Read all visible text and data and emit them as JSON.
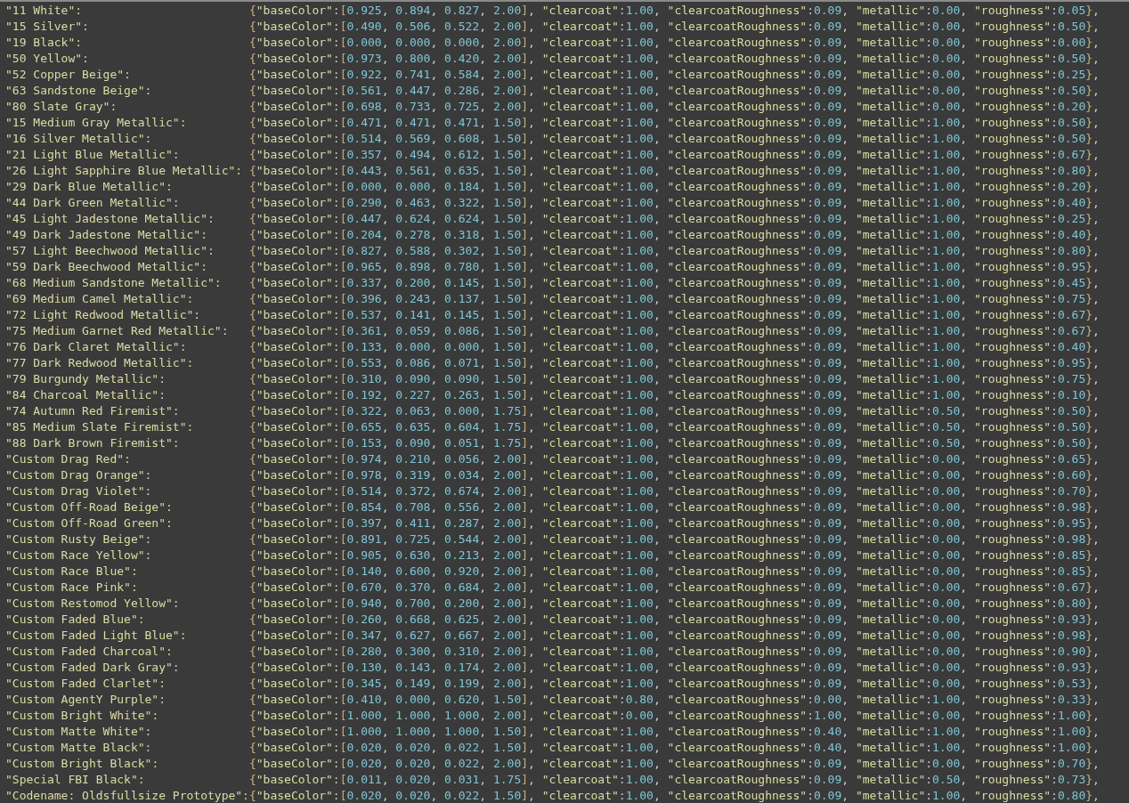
{
  "editor": {
    "lines": [
      {
        "key": "\"11 White\":",
        "code": "{\"baseColor\":[0.925, 0.894, 0.827, 2.00], \"clearcoat\":1.00, \"clearcoatRoughness\":0.09, \"metallic\":0.00, \"roughness\":0.05},"
      },
      {
        "key": "\"15 Silver\":",
        "code": "{\"baseColor\":[0.490, 0.506, 0.522, 2.00], \"clearcoat\":1.00, \"clearcoatRoughness\":0.09, \"metallic\":0.00, \"roughness\":0.50},"
      },
      {
        "key": "\"19 Black\":",
        "code": "{\"baseColor\":[0.000, 0.000, 0.000, 2.00], \"clearcoat\":1.00, \"clearcoatRoughness\":0.09, \"metallic\":0.00, \"roughness\":0.00},"
      },
      {
        "key": "\"50 Yellow\":",
        "code": "{\"baseColor\":[0.973, 0.800, 0.420, 2.00], \"clearcoat\":1.00, \"clearcoatRoughness\":0.09, \"metallic\":0.00, \"roughness\":0.50},"
      },
      {
        "key": "\"52 Copper Beige\":",
        "code": "{\"baseColor\":[0.922, 0.741, 0.584, 2.00], \"clearcoat\":1.00, \"clearcoatRoughness\":0.09, \"metallic\":0.00, \"roughness\":0.25},"
      },
      {
        "key": "\"63 Sandstone Beige\":",
        "code": "{\"baseColor\":[0.561, 0.447, 0.286, 2.00], \"clearcoat\":1.00, \"clearcoatRoughness\":0.09, \"metallic\":0.00, \"roughness\":0.50},"
      },
      {
        "key": "\"80 Slate Gray\":",
        "code": "{\"baseColor\":[0.698, 0.733, 0.725, 2.00], \"clearcoat\":1.00, \"clearcoatRoughness\":0.09, \"metallic\":0.00, \"roughness\":0.20},"
      },
      {
        "key": "\"15 Medium Gray Metallic\":",
        "code": "{\"baseColor\":[0.471, 0.471, 0.471, 1.50], \"clearcoat\":1.00, \"clearcoatRoughness\":0.09, \"metallic\":1.00, \"roughness\":0.50},"
      },
      {
        "key": "\"16 Silver Metallic\":",
        "code": "{\"baseColor\":[0.514, 0.569, 0.608, 1.50], \"clearcoat\":1.00, \"clearcoatRoughness\":0.09, \"metallic\":1.00, \"roughness\":0.50},"
      },
      {
        "key": "\"21 Light Blue Metallic\":",
        "code": "{\"baseColor\":[0.357, 0.494, 0.612, 1.50], \"clearcoat\":1.00, \"clearcoatRoughness\":0.09, \"metallic\":1.00, \"roughness\":0.67},"
      },
      {
        "key": "\"26 Light Sapphire Blue Metallic\":",
        "code": "{\"baseColor\":[0.443, 0.561, 0.635, 1.50], \"clearcoat\":1.00, \"clearcoatRoughness\":0.09, \"metallic\":1.00, \"roughness\":0.80},"
      },
      {
        "key": "\"29 Dark Blue Metallic\":",
        "code": "{\"baseColor\":[0.000, 0.000, 0.184, 1.50], \"clearcoat\":1.00, \"clearcoatRoughness\":0.09, \"metallic\":1.00, \"roughness\":0.20},"
      },
      {
        "key": "\"44 Dark Green Metallic\":",
        "code": "{\"baseColor\":[0.290, 0.463, 0.322, 1.50], \"clearcoat\":1.00, \"clearcoatRoughness\":0.09, \"metallic\":1.00, \"roughness\":0.40},"
      },
      {
        "key": "\"45 Light Jadestone Metallic\":",
        "code": "{\"baseColor\":[0.447, 0.624, 0.624, 1.50], \"clearcoat\":1.00, \"clearcoatRoughness\":0.09, \"metallic\":1.00, \"roughness\":0.25},"
      },
      {
        "key": "\"49 Dark Jadestone Metallic\":",
        "code": "{\"baseColor\":[0.204, 0.278, 0.318, 1.50], \"clearcoat\":1.00, \"clearcoatRoughness\":0.09, \"metallic\":1.00, \"roughness\":0.40},"
      },
      {
        "key": "\"57 Light Beechwood Metallic\":",
        "code": "{\"baseColor\":[0.827, 0.588, 0.302, 1.50], \"clearcoat\":1.00, \"clearcoatRoughness\":0.09, \"metallic\":1.00, \"roughness\":0.80},"
      },
      {
        "key": "\"59 Dark Beechwood Metallic\":",
        "code": "{\"baseColor\":[0.965, 0.898, 0.780, 1.50], \"clearcoat\":1.00, \"clearcoatRoughness\":0.09, \"metallic\":1.00, \"roughness\":0.95},"
      },
      {
        "key": "\"68 Medium Sandstone Metallic\":",
        "code": "{\"baseColor\":[0.337, 0.200, 0.145, 1.50], \"clearcoat\":1.00, \"clearcoatRoughness\":0.09, \"metallic\":1.00, \"roughness\":0.45},"
      },
      {
        "key": "\"69 Medium Camel Metallic\":",
        "code": "{\"baseColor\":[0.396, 0.243, 0.137, 1.50], \"clearcoat\":1.00, \"clearcoatRoughness\":0.09, \"metallic\":1.00, \"roughness\":0.75},"
      },
      {
        "key": "\"72 Light Redwood Metallic\":",
        "code": "{\"baseColor\":[0.537, 0.141, 0.145, 1.50], \"clearcoat\":1.00, \"clearcoatRoughness\":0.09, \"metallic\":1.00, \"roughness\":0.67},"
      },
      {
        "key": "\"75 Medium Garnet Red Metallic\":",
        "code": "{\"baseColor\":[0.361, 0.059, 0.086, 1.50], \"clearcoat\":1.00, \"clearcoatRoughness\":0.09, \"metallic\":1.00, \"roughness\":0.67},"
      },
      {
        "key": "\"76 Dark Claret Metallic\":",
        "code": "{\"baseColor\":[0.133, 0.000, 0.000, 1.50], \"clearcoat\":1.00, \"clearcoatRoughness\":0.09, \"metallic\":1.00, \"roughness\":0.40},"
      },
      {
        "key": "\"77 Dark Redwood Metallic\":",
        "code": "{\"baseColor\":[0.553, 0.086, 0.071, 1.50], \"clearcoat\":1.00, \"clearcoatRoughness\":0.09, \"metallic\":1.00, \"roughness\":0.95},"
      },
      {
        "key": "\"79 Burgundy Metallic\":",
        "code": "{\"baseColor\":[0.310, 0.090, 0.090, 1.50], \"clearcoat\":1.00, \"clearcoatRoughness\":0.09, \"metallic\":1.00, \"roughness\":0.75},"
      },
      {
        "key": "\"84 Charcoal Metallic\":",
        "code": "{\"baseColor\":[0.192, 0.227, 0.263, 1.50], \"clearcoat\":1.00, \"clearcoatRoughness\":0.09, \"metallic\":1.00, \"roughness\":0.10},"
      },
      {
        "key": "\"74 Autumn Red Firemist\":",
        "code": "{\"baseColor\":[0.322, 0.063, 0.000, 1.75], \"clearcoat\":1.00, \"clearcoatRoughness\":0.09, \"metallic\":0.50, \"roughness\":0.50},"
      },
      {
        "key": "\"85 Medium Slate Firemist\":",
        "code": "{\"baseColor\":[0.655, 0.635, 0.604, 1.75], \"clearcoat\":1.00, \"clearcoatRoughness\":0.09, \"metallic\":0.50, \"roughness\":0.50},"
      },
      {
        "key": "\"88 Dark Brown Firemist\":",
        "code": "{\"baseColor\":[0.153, 0.090, 0.051, 1.75], \"clearcoat\":1.00, \"clearcoatRoughness\":0.09, \"metallic\":0.50, \"roughness\":0.50},"
      },
      {
        "key": "\"Custom Drag Red\":",
        "code": "{\"baseColor\":[0.974, 0.210, 0.056, 2.00], \"clearcoat\":1.00, \"clearcoatRoughness\":0.09, \"metallic\":0.00, \"roughness\":0.65},"
      },
      {
        "key": "\"Custom Drag Orange\":",
        "code": "{\"baseColor\":[0.978, 0.319, 0.034, 2.00], \"clearcoat\":1.00, \"clearcoatRoughness\":0.09, \"metallic\":0.00, \"roughness\":0.60},"
      },
      {
        "key": "\"Custom Drag Violet\":",
        "code": "{\"baseColor\":[0.514, 0.372, 0.674, 2.00], \"clearcoat\":1.00, \"clearcoatRoughness\":0.09, \"metallic\":0.00, \"roughness\":0.70},"
      },
      {
        "key": "\"Custom Off-Road Beige\":",
        "code": "{\"baseColor\":[0.854, 0.708, 0.556, 2.00], \"clearcoat\":1.00, \"clearcoatRoughness\":0.09, \"metallic\":0.00, \"roughness\":0.98},"
      },
      {
        "key": "\"Custom Off-Road Green\":",
        "code": "{\"baseColor\":[0.397, 0.411, 0.287, 2.00], \"clearcoat\":1.00, \"clearcoatRoughness\":0.09, \"metallic\":0.00, \"roughness\":0.95},"
      },
      {
        "key": "\"Custom Rusty Beige\":",
        "code": "{\"baseColor\":[0.891, 0.725, 0.544, 2.00], \"clearcoat\":1.00, \"clearcoatRoughness\":0.09, \"metallic\":0.00, \"roughness\":0.98},"
      },
      {
        "key": "\"Custom Race Yellow\":",
        "code": "{\"baseColor\":[0.905, 0.630, 0.213, 2.00], \"clearcoat\":1.00, \"clearcoatRoughness\":0.09, \"metallic\":0.00, \"roughness\":0.85},"
      },
      {
        "key": "\"Custom Race Blue\":",
        "code": "{\"baseColor\":[0.140, 0.600, 0.920, 2.00], \"clearcoat\":1.00, \"clearcoatRoughness\":0.09, \"metallic\":0.00, \"roughness\":0.85},"
      },
      {
        "key": "\"Custom Race Pink\":",
        "code": "{\"baseColor\":[0.670, 0.370, 0.684, 2.00], \"clearcoat\":1.00, \"clearcoatRoughness\":0.09, \"metallic\":0.00, \"roughness\":0.67},"
      },
      {
        "key": "\"Custom Restomod Yellow\":",
        "code": "{\"baseColor\":[0.940, 0.700, 0.200, 2.00], \"clearcoat\":1.00, \"clearcoatRoughness\":0.09, \"metallic\":0.00, \"roughness\":0.80},"
      },
      {
        "key": "\"Custom Faded Blue\":",
        "code": "{\"baseColor\":[0.260, 0.668, 0.625, 2.00], \"clearcoat\":1.00, \"clearcoatRoughness\":0.09, \"metallic\":0.00, \"roughness\":0.93},"
      },
      {
        "key": "\"Custom Faded Light Blue\":",
        "code": "{\"baseColor\":[0.347, 0.627, 0.667, 2.00], \"clearcoat\":1.00, \"clearcoatRoughness\":0.09, \"metallic\":0.00, \"roughness\":0.98},"
      },
      {
        "key": "\"Custom Faded Charcoal\":",
        "code": "{\"baseColor\":[0.280, 0.300, 0.310, 2.00], \"clearcoat\":1.00, \"clearcoatRoughness\":0.09, \"metallic\":0.00, \"roughness\":0.90},"
      },
      {
        "key": "\"Custom Faded Dark Gray\":",
        "code": "{\"baseColor\":[0.130, 0.143, 0.174, 2.00], \"clearcoat\":1.00, \"clearcoatRoughness\":0.09, \"metallic\":0.00, \"roughness\":0.93},"
      },
      {
        "key": "\"Custom Faded Clarlet\":",
        "code": "{\"baseColor\":[0.345, 0.149, 0.199, 2.00], \"clearcoat\":1.00, \"clearcoatRoughness\":0.09, \"metallic\":0.00, \"roughness\":0.53},"
      },
      {
        "key": "\"Custom AgentY Purple\":",
        "code": "{\"baseColor\":[0.410, 0.000, 0.620, 1.50], \"clearcoat\":0.80, \"clearcoatRoughness\":0.00, \"metallic\":1.00, \"roughness\":0.33},"
      },
      {
        "key": "\"Custom Bright White\":",
        "code": "{\"baseColor\":[1.000, 1.000, 1.000, 2.00], \"clearcoat\":0.00, \"clearcoatRoughness\":1.00, \"metallic\":0.00, \"roughness\":1.00},"
      },
      {
        "key": "\"Custom Matte White\":",
        "code": "{\"baseColor\":[1.000, 1.000, 1.000, 1.50], \"clearcoat\":1.00, \"clearcoatRoughness\":0.40, \"metallic\":1.00, \"roughness\":1.00},"
      },
      {
        "key": "\"Custom Matte Black\":",
        "code": "{\"baseColor\":[0.020, 0.020, 0.022, 1.50], \"clearcoat\":1.00, \"clearcoatRoughness\":0.40, \"metallic\":1.00, \"roughness\":1.00},"
      },
      {
        "key": "\"Custom Bright Black\":",
        "code": "{\"baseColor\":[0.020, 0.020, 0.022, 2.00], \"clearcoat\":1.00, \"clearcoatRoughness\":0.09, \"metallic\":0.00, \"roughness\":0.70},"
      },
      {
        "key": "\"Special FBI Black\":",
        "code": "{\"baseColor\":[0.011, 0.020, 0.031, 1.75], \"clearcoat\":1.00, \"clearcoatRoughness\":0.09, \"metallic\":0.50, \"roughness\":0.73},"
      },
      {
        "key": "\"Codename: Oldsfullsize Prototype\":",
        "code": "{\"baseColor\":[0.020, 0.020, 0.022, 1.50], \"clearcoat\":1.00, \"clearcoatRoughness\":0.09, \"metallic\":1.00, \"roughness\":0.80},"
      }
    ]
  }
}
